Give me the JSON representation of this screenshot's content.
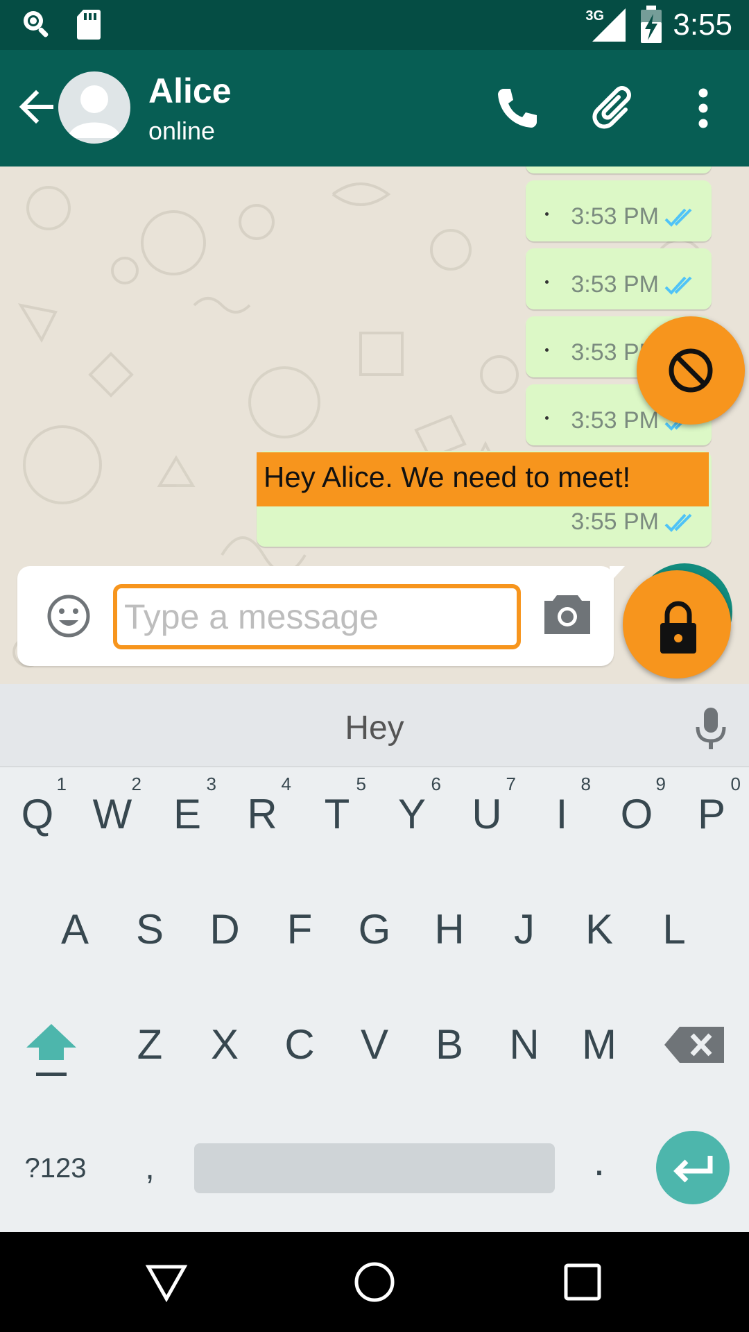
{
  "status_bar": {
    "time": "3:55",
    "network": "3G",
    "icons": [
      "search-icon",
      "sd-card-icon",
      "signal-icon",
      "battery-charging-icon"
    ]
  },
  "header": {
    "contact_name": "Alice",
    "contact_status": "online",
    "actions": [
      "call-icon",
      "attach-icon",
      "more-options-icon"
    ]
  },
  "messages": [
    {
      "time": "3:53 PM",
      "ticks": "read"
    },
    {
      "time": "3:53 PM",
      "ticks": "read"
    },
    {
      "time": "3:53 PM",
      "ticks": "read"
    },
    {
      "time": "3:53 PM",
      "ticks": "read"
    },
    {
      "text": "Hey Alice. We need to meet!",
      "time": "3:55 PM",
      "ticks": "read"
    }
  ],
  "composer": {
    "placeholder": "Type a message",
    "value": ""
  },
  "keyboard": {
    "suggestion": "Hey",
    "row1": [
      {
        "key": "Q",
        "sup": "1"
      },
      {
        "key": "W",
        "sup": "2"
      },
      {
        "key": "E",
        "sup": "3"
      },
      {
        "key": "R",
        "sup": "4"
      },
      {
        "key": "T",
        "sup": "5"
      },
      {
        "key": "Y",
        "sup": "6"
      },
      {
        "key": "U",
        "sup": "7"
      },
      {
        "key": "I",
        "sup": "8"
      },
      {
        "key": "O",
        "sup": "9"
      },
      {
        "key": "P",
        "sup": "0"
      }
    ],
    "row2": [
      "A",
      "S",
      "D",
      "F",
      "G",
      "H",
      "J",
      "K",
      "L"
    ],
    "row3": [
      "Z",
      "X",
      "C",
      "V",
      "B",
      "N",
      "M"
    ],
    "symbols_key": "?123",
    "comma_key": ",",
    "period_key": "."
  },
  "colors": {
    "header": "#075e54",
    "status_bar": "#054d44",
    "bubble_out": "#dcf8c6",
    "highlight": "#f7951d",
    "ticks": "#4fc3f7",
    "accent": "#4db6ac"
  }
}
